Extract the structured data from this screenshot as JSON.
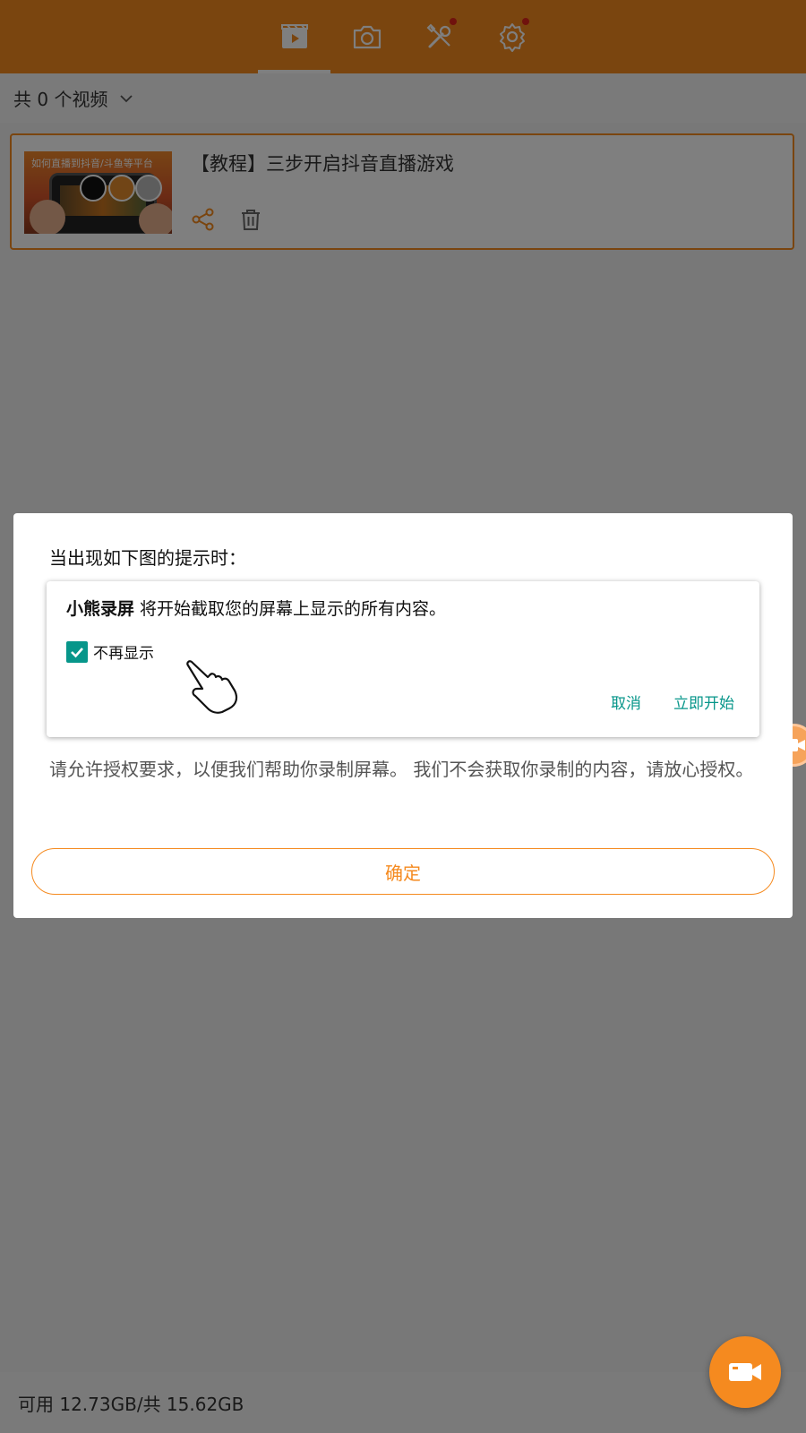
{
  "colors": {
    "brand": "#f58a1f",
    "teal": "#07968a",
    "badge": "#e0251b"
  },
  "header": {
    "tabs": [
      {
        "icon": "video-list-icon",
        "active": true
      },
      {
        "icon": "camera-icon",
        "active": false
      },
      {
        "icon": "tools-icon",
        "active": false,
        "badge": true
      },
      {
        "icon": "settings-icon",
        "active": false,
        "badge": true
      }
    ]
  },
  "count_bar": {
    "label": "共 0 个视频"
  },
  "video": {
    "thumbnail_caption": "如何直播到抖音/斗鱼等平台",
    "title": "【教程】三步开启抖音直播游戏"
  },
  "storage": {
    "label": "可用 12.73GB/共 15.62GB"
  },
  "dialog": {
    "heading": "当出现如下图的提示时：",
    "sample": {
      "app_name": "小熊录屏",
      "message": " 将开始截取您的屏幕上显示的所有内容。",
      "checkbox_label": "不再显示",
      "checkbox_checked": true,
      "cancel_label": "取消",
      "start_label": "立即开始"
    },
    "body": "请允许授权要求，以便我们帮助你录制屏幕。 我们不会获取你录制的内容，请放心授权。",
    "ok_label": "确定"
  }
}
